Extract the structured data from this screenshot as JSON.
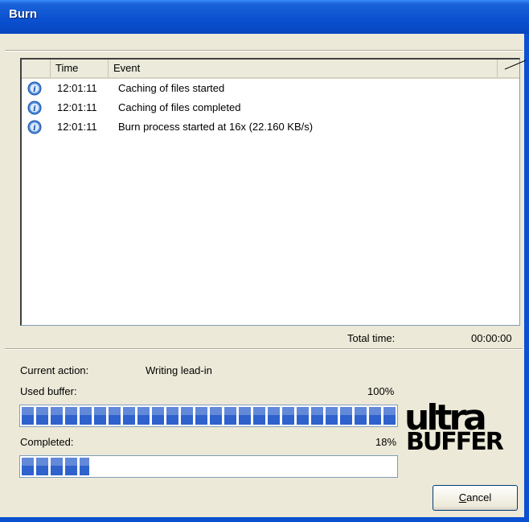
{
  "window": {
    "title": "Burn"
  },
  "log": {
    "columns": [
      "",
      "Time",
      "Event"
    ],
    "rows": [
      {
        "icon": "info-icon",
        "time": "12:01:11",
        "event": "Caching of files started"
      },
      {
        "icon": "info-icon",
        "time": "12:01:11",
        "event": "Caching of files completed"
      },
      {
        "icon": "info-icon",
        "time": "12:01:11",
        "event": "Burn process started at 16x (22.160 KB/s)"
      }
    ]
  },
  "total_time": {
    "label": "Total time:",
    "value": "00:00:00"
  },
  "current_action": {
    "label": "Current action:",
    "value": "Writing lead-in"
  },
  "used_buffer": {
    "label": "Used buffer:",
    "percent_text": "100%",
    "fraction": 1.0
  },
  "completed": {
    "label": "Completed:",
    "percent_text": "18%",
    "fraction": 0.18
  },
  "logo": {
    "line1": "ultra",
    "line2": "BUFFER"
  },
  "cancel_button": {
    "mnemonic": "C",
    "rest": "ancel"
  },
  "colors": {
    "progress": "#2f62cc",
    "titlebar": "#0a50d0"
  }
}
